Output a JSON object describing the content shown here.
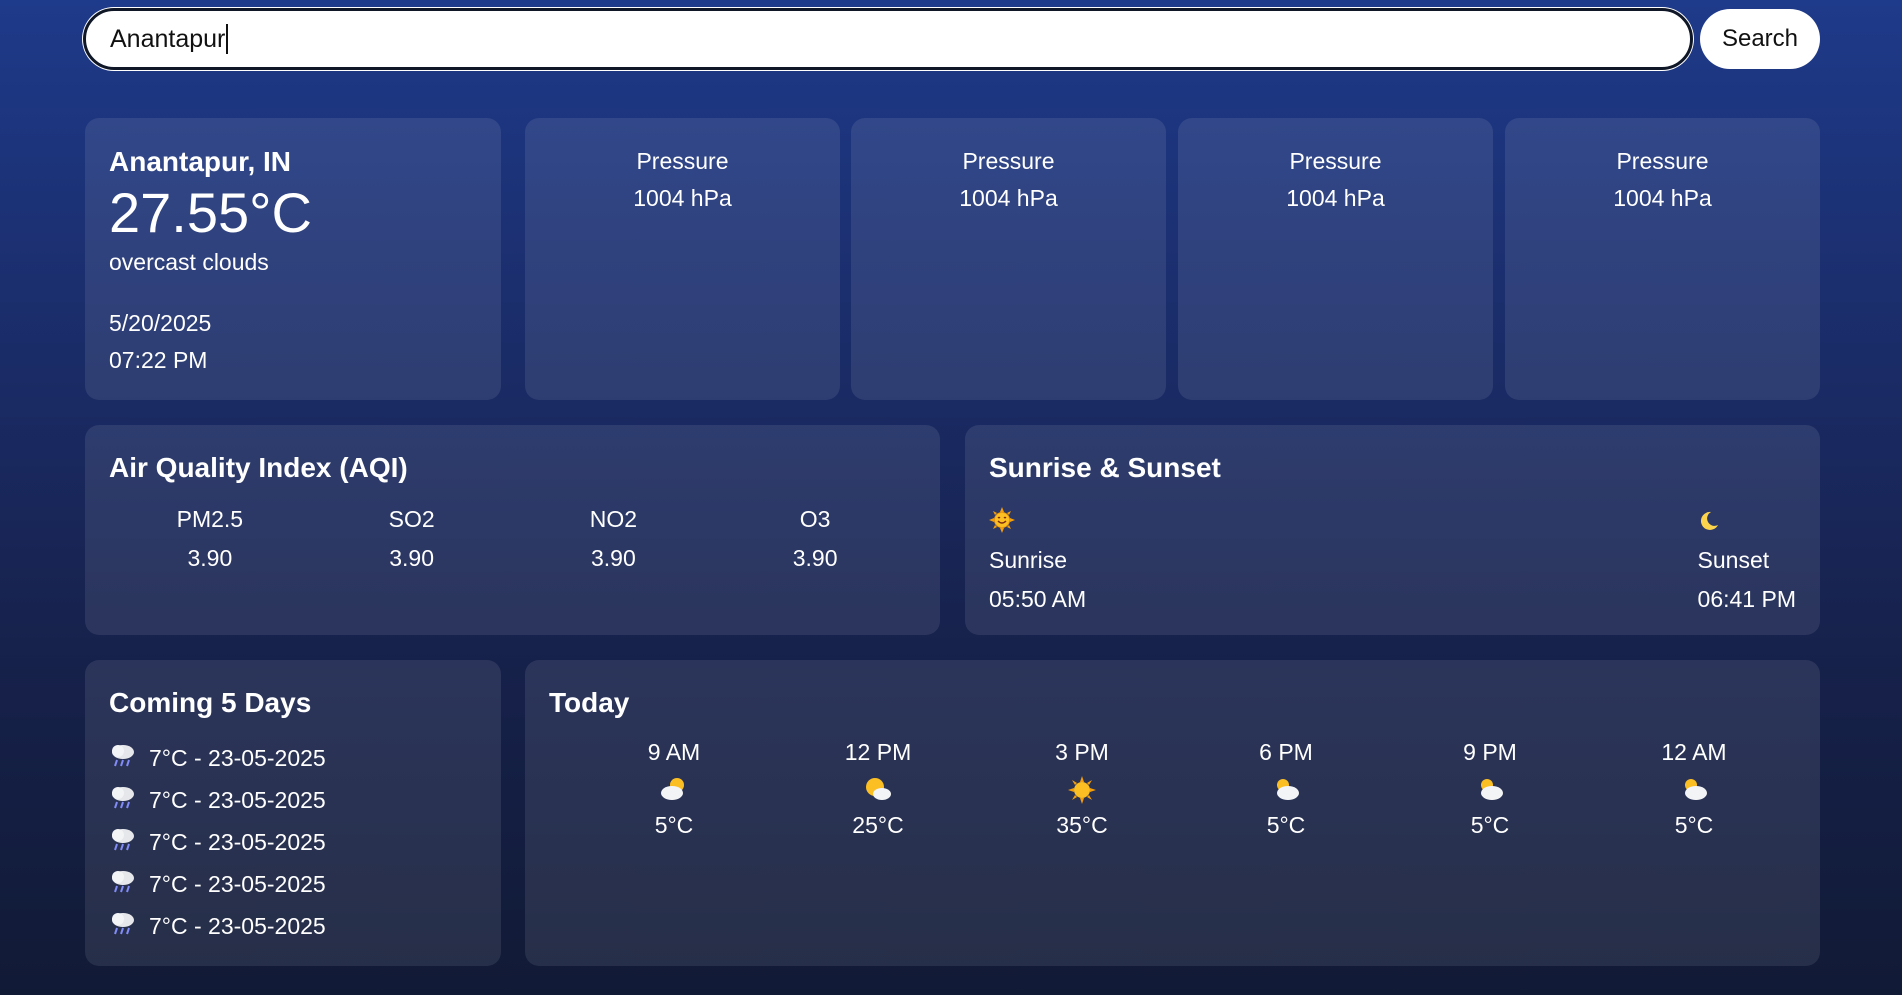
{
  "search": {
    "value": "Anantapur",
    "button_label": "Search"
  },
  "current": {
    "location": "Anantapur, IN",
    "temperature": "27.55°C",
    "description": "overcast clouds",
    "date": "5/20/2025",
    "time": "07:22 PM"
  },
  "pressure_cards": [
    {
      "label": "Pressure",
      "value": "1004 hPa"
    },
    {
      "label": "Pressure",
      "value": "1004 hPa"
    },
    {
      "label": "Pressure",
      "value": "1004 hPa"
    },
    {
      "label": "Pressure",
      "value": "1004 hPa"
    }
  ],
  "aqi": {
    "title": "Air Quality Index (AQI)",
    "items": [
      {
        "label": "PM2.5",
        "value": "3.90"
      },
      {
        "label": "SO2",
        "value": "3.90"
      },
      {
        "label": "NO2",
        "value": "3.90"
      },
      {
        "label": "O3",
        "value": "3.90"
      }
    ]
  },
  "sun": {
    "title": "Sunrise & Sunset",
    "sunrise": {
      "icon": "sun-smile-icon",
      "label": "Sunrise",
      "time": "05:50 AM"
    },
    "sunset": {
      "icon": "crescent-moon-icon",
      "label": "Sunset",
      "time": "06:41 PM"
    }
  },
  "forecast": {
    "title": "Coming 5 Days",
    "icon": "rain-cloud-icon",
    "items": [
      {
        "text": "7°C - 23-05-2025"
      },
      {
        "text": "7°C - 23-05-2025"
      },
      {
        "text": "7°C - 23-05-2025"
      },
      {
        "text": "7°C - 23-05-2025"
      },
      {
        "text": "7°C - 23-05-2025"
      }
    ]
  },
  "today": {
    "title": "Today",
    "hours": [
      {
        "time": "9 AM",
        "icon": "sun-behind-cloud-icon",
        "temp": "5°C"
      },
      {
        "time": "12 PM",
        "icon": "sun-behind-cloud-icon",
        "temp": "25°C"
      },
      {
        "time": "3 PM",
        "icon": "sun-icon",
        "temp": "35°C"
      },
      {
        "time": "6 PM",
        "icon": "sun-behind-cloud-icon",
        "temp": "5°C"
      },
      {
        "time": "9 PM",
        "icon": "sun-behind-cloud-icon",
        "temp": "5°C"
      },
      {
        "time": "12 AM",
        "icon": "sun-behind-cloud-icon",
        "temp": "5°C"
      }
    ]
  }
}
